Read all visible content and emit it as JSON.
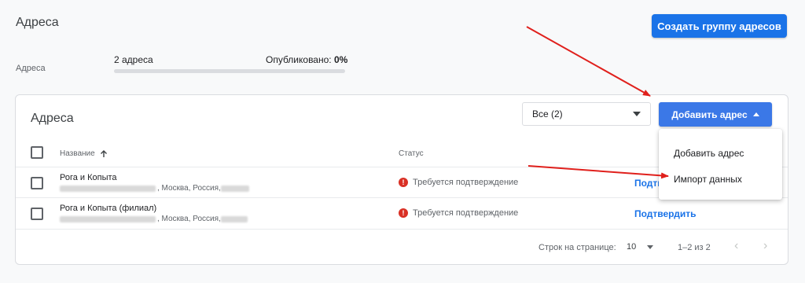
{
  "header": {
    "title": "Адреса",
    "create_group_label": "Создать группу адресов"
  },
  "summary": {
    "label": "Адреса",
    "count": "2 адреса",
    "published_label": "Опубликовано:",
    "published_value": "0%",
    "published_fraction": 0
  },
  "card": {
    "title": "Адреса",
    "filter_value": "Все (2)",
    "add_address_label": "Добавить адрес",
    "columns": {
      "name": "Название",
      "status": "Статус"
    },
    "rows": [
      {
        "name": "Рога и Копыта",
        "address": ", Москва, Россия, ",
        "status": "Требуется подтверждение",
        "action": "Подтвердить"
      },
      {
        "name": "Рога и Копыта (филиал)",
        "address": ", Москва, Россия, ",
        "status": "Требуется подтверждение",
        "action": "Подтвердить"
      }
    ],
    "pagination": {
      "rows_label": "Строк на странице:",
      "rows_value": "10",
      "range": "1–2 из 2"
    }
  },
  "menu": {
    "items": [
      "Добавить адрес",
      "Импорт данных"
    ]
  },
  "colors": {
    "accent": "#1a73e8",
    "error": "#d93025",
    "annotation_arrow": "#e0201c"
  },
  "icons": {
    "sort": "arrow-up-icon",
    "status": "error-icon",
    "prev": "chevron-left-icon",
    "next": "chevron-right-icon"
  }
}
